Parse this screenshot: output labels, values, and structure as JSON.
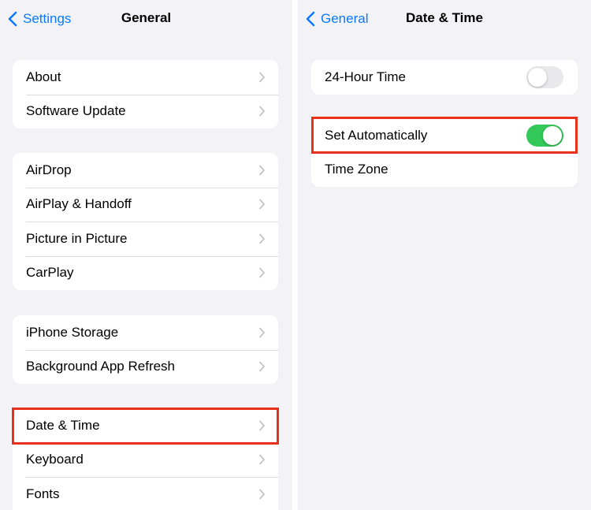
{
  "left": {
    "back_label": "Settings",
    "title": "General",
    "groups": [
      [
        {
          "label": "About"
        },
        {
          "label": "Software Update"
        }
      ],
      [
        {
          "label": "AirDrop"
        },
        {
          "label": "AirPlay & Handoff"
        },
        {
          "label": "Picture in Picture"
        },
        {
          "label": "CarPlay"
        }
      ],
      [
        {
          "label": "iPhone Storage"
        },
        {
          "label": "Background App Refresh"
        }
      ],
      [
        {
          "label": "Date & Time"
        },
        {
          "label": "Keyboard"
        },
        {
          "label": "Fonts"
        }
      ]
    ]
  },
  "right": {
    "back_label": "General",
    "title": "Date & Time",
    "hour24": {
      "label": "24-Hour Time",
      "on": false
    },
    "set_auto": {
      "label": "Set Automatically",
      "on": true
    },
    "timezone": {
      "label": "Time Zone"
    }
  },
  "colors": {
    "accent": "#0a7aff",
    "toggle_on": "#34c759",
    "highlight": "#e8311a",
    "background": "#f2f2f7"
  },
  "icons": {
    "back": "chevron-left-icon",
    "disclosure": "chevron-right-icon"
  }
}
